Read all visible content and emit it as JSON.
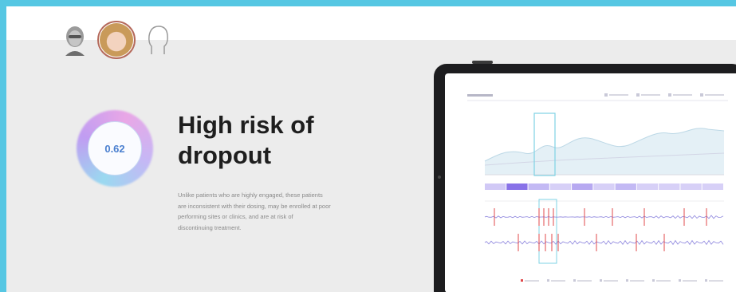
{
  "avatars": [
    {
      "name": "older-man",
      "selected": false
    },
    {
      "name": "young-woman",
      "selected": true
    },
    {
      "name": "outline-head",
      "selected": false
    }
  ],
  "score": {
    "value": "0.62"
  },
  "headline": {
    "line1": "High risk of",
    "line2": "dropout"
  },
  "description": {
    "lines": [
      "Unlike patients who are highly engaged, these patients",
      "are inconsistent with their dosing, may be enrolled at poor",
      "performing sites or clinics, and are at risk of",
      "discontinuing treatment."
    ]
  },
  "colors": {
    "accent_frame": "#56c7e3",
    "score_text": "#4a7fcf",
    "bar_purple": "#7b63e6",
    "bar_light": "#c9bff4",
    "signal_red": "#e0484b",
    "signal_blue": "#5a4fcf"
  },
  "tablet": {
    "legend_items": 4,
    "timeline_segments": [
      0.35,
      0.9,
      0.45,
      0.3,
      0.55,
      0.3,
      0.45,
      0.3,
      0.3,
      0.3,
      0.3
    ],
    "footer_items": 8
  }
}
